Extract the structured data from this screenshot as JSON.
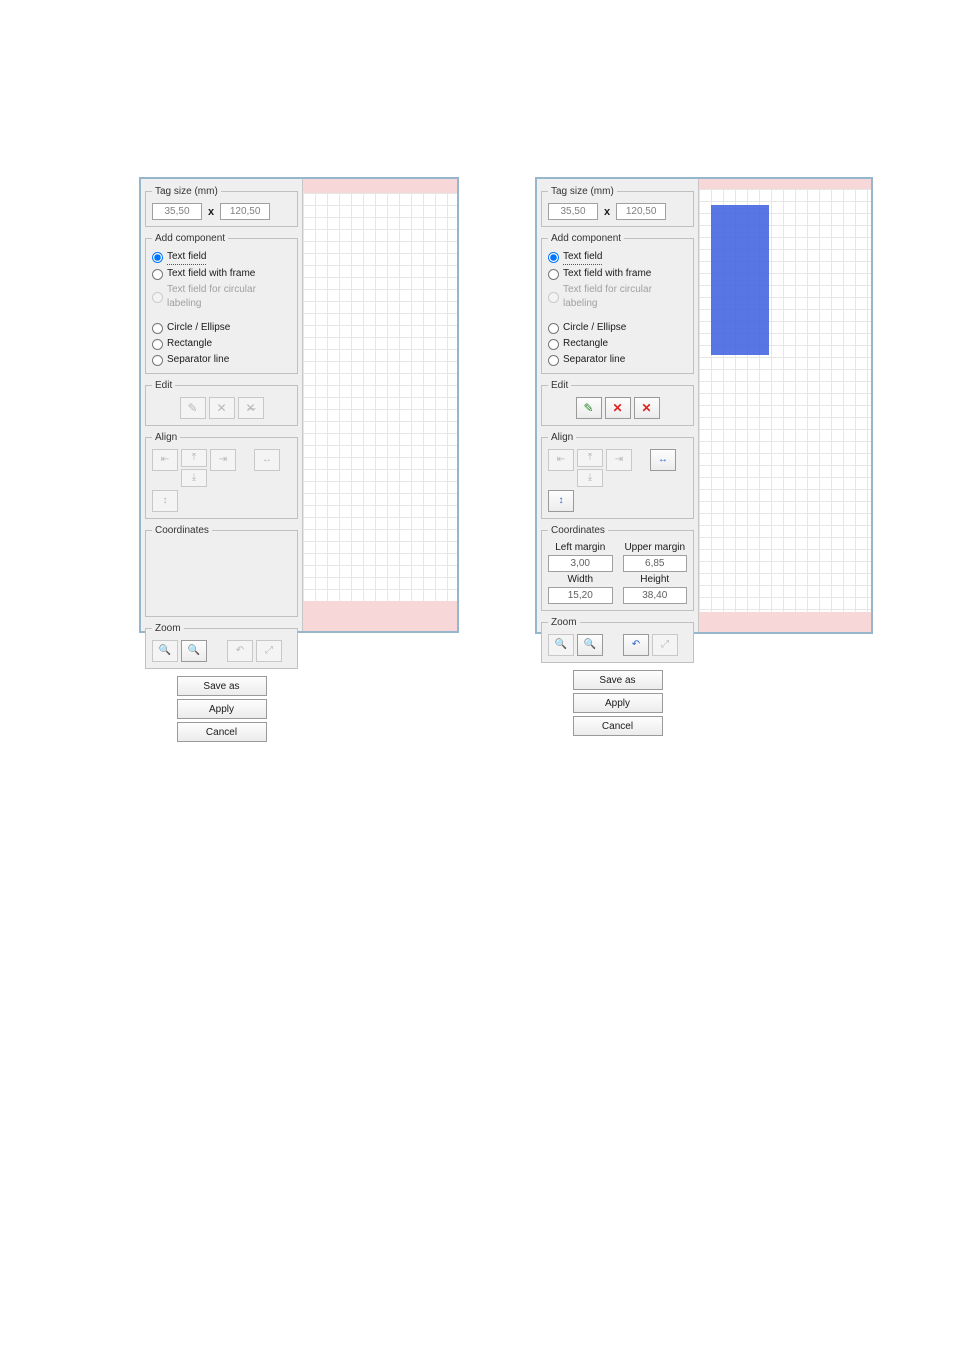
{
  "panel1": {
    "tag_size": {
      "legend": "Tag size (mm)",
      "w": "35,50",
      "sep": "x",
      "h": "120,50"
    },
    "add_component": {
      "legend": "Add component",
      "items": [
        {
          "label": "Text field",
          "checked": true,
          "disabled": false,
          "focus": true
        },
        {
          "label": "Text field with frame",
          "checked": false,
          "disabled": false
        },
        {
          "label": "Text field for circular labeling",
          "checked": false,
          "disabled": true
        },
        {
          "label": "Circle / Ellipse",
          "checked": false,
          "disabled": false
        },
        {
          "label": "Rectangle",
          "checked": false,
          "disabled": false
        },
        {
          "label": "Separator line",
          "checked": false,
          "disabled": false
        }
      ]
    },
    "edit": {
      "legend": "Edit",
      "buttons": [
        {
          "name": "edit-button",
          "icon": "edit-icon",
          "glyph": "✎",
          "enabled": false
        },
        {
          "name": "delete-button",
          "icon": "delete-icon",
          "glyph": "✕",
          "enabled": false
        },
        {
          "name": "delete-all-button",
          "icon": "delete-all-icon",
          "glyph": "✕̶",
          "enabled": false
        }
      ]
    },
    "align": {
      "legend": "Align",
      "buttons": [
        {
          "name": "align-left-button",
          "icon": "align-left-icon",
          "glyph": "⇤"
        },
        {
          "name": "align-top-button",
          "icon": "align-top-icon",
          "glyph": "⤒"
        },
        {
          "name": "align-right-button",
          "icon": "align-right-icon",
          "glyph": "⇥"
        },
        {
          "name": "align-bottom-button",
          "icon": "align-bottom-icon",
          "glyph": "⤓"
        },
        {
          "name": "center-horiz-button",
          "icon": "center-horiz-icon",
          "glyph": "↔"
        },
        {
          "name": "center-vert-button",
          "icon": "center-vert-icon",
          "glyph": "↕"
        }
      ]
    },
    "coordinates": {
      "legend": "Coordinates"
    },
    "zoom": {
      "legend": "Zoom",
      "buttons": [
        {
          "name": "zoom-out-button",
          "icon": "zoom-out-icon",
          "glyph": "🔍",
          "enabled": false
        },
        {
          "name": "zoom-in-button",
          "icon": "zoom-in-icon",
          "glyph": "🔍",
          "enabled": true
        },
        {
          "name": "undo-button",
          "icon": "undo-icon",
          "glyph": "↶",
          "enabled": false
        },
        {
          "name": "zoom-fit-button",
          "icon": "zoom-fit-icon",
          "glyph": "⤢",
          "enabled": false
        }
      ]
    },
    "bottom": {
      "save_as": "Save as",
      "apply": "Apply",
      "cancel": "Cancel"
    }
  },
  "panel2": {
    "tag_size": {
      "legend": "Tag size (mm)",
      "w": "35,50",
      "sep": "x",
      "h": "120,50"
    },
    "add_component": {
      "legend": "Add component",
      "items": [
        {
          "label": "Text field",
          "checked": true,
          "disabled": false,
          "focus": true
        },
        {
          "label": "Text field with frame",
          "checked": false,
          "disabled": false
        },
        {
          "label": "Text field for circular labeling",
          "checked": false,
          "disabled": true
        },
        {
          "label": "Circle / Ellipse",
          "checked": false,
          "disabled": false
        },
        {
          "label": "Rectangle",
          "checked": false,
          "disabled": false
        },
        {
          "label": "Separator line",
          "checked": false,
          "disabled": false
        }
      ]
    },
    "edit": {
      "legend": "Edit",
      "buttons": [
        {
          "name": "edit-button",
          "icon": "edit-icon",
          "glyph": "✎",
          "enabled": true,
          "color": "green"
        },
        {
          "name": "delete-button",
          "icon": "delete-icon",
          "glyph": "✕",
          "enabled": true,
          "color": "red"
        },
        {
          "name": "delete-all-button",
          "icon": "delete-all-icon",
          "glyph": "✕",
          "enabled": true,
          "color": "red"
        }
      ]
    },
    "align": {
      "legend": "Align",
      "left_buttons": [
        {
          "name": "align-left-button",
          "icon": "align-left-icon",
          "glyph": "⇤"
        },
        {
          "name": "align-top-button",
          "icon": "align-top-icon",
          "glyph": "⤒"
        },
        {
          "name": "align-right-button",
          "icon": "align-right-icon",
          "glyph": "⇥"
        },
        {
          "name": "align-bottom-button",
          "icon": "align-bottom-icon",
          "glyph": "⤓"
        }
      ],
      "right_buttons": [
        {
          "name": "center-horiz-button",
          "icon": "center-horiz-icon",
          "glyph": "↔",
          "color": "blue"
        },
        {
          "name": "center-vert-button",
          "icon": "center-vert-icon",
          "glyph": "↕",
          "color": "blue"
        }
      ]
    },
    "coordinates": {
      "legend": "Coordinates",
      "left_margin_label": "Left margin",
      "upper_margin_label": "Upper margin",
      "width_label": "Width",
      "height_label": "Height",
      "left_margin": "3,00",
      "upper_margin": "6,85",
      "width": "15,20",
      "height": "38,40"
    },
    "zoom": {
      "legend": "Zoom",
      "buttons": [
        {
          "name": "zoom-out-button",
          "icon": "zoom-out-icon",
          "glyph": "🔍",
          "enabled": false
        },
        {
          "name": "zoom-in-button",
          "icon": "zoom-in-icon",
          "glyph": "🔍",
          "enabled": true
        },
        {
          "name": "undo-button",
          "icon": "undo-icon",
          "glyph": "↶",
          "enabled": true,
          "color": "blue"
        },
        {
          "name": "zoom-fit-button",
          "icon": "zoom-fit-icon",
          "glyph": "⤢",
          "enabled": false
        }
      ]
    },
    "bottom": {
      "save_as": "Save as",
      "apply": "Apply",
      "cancel": "Cancel"
    }
  }
}
